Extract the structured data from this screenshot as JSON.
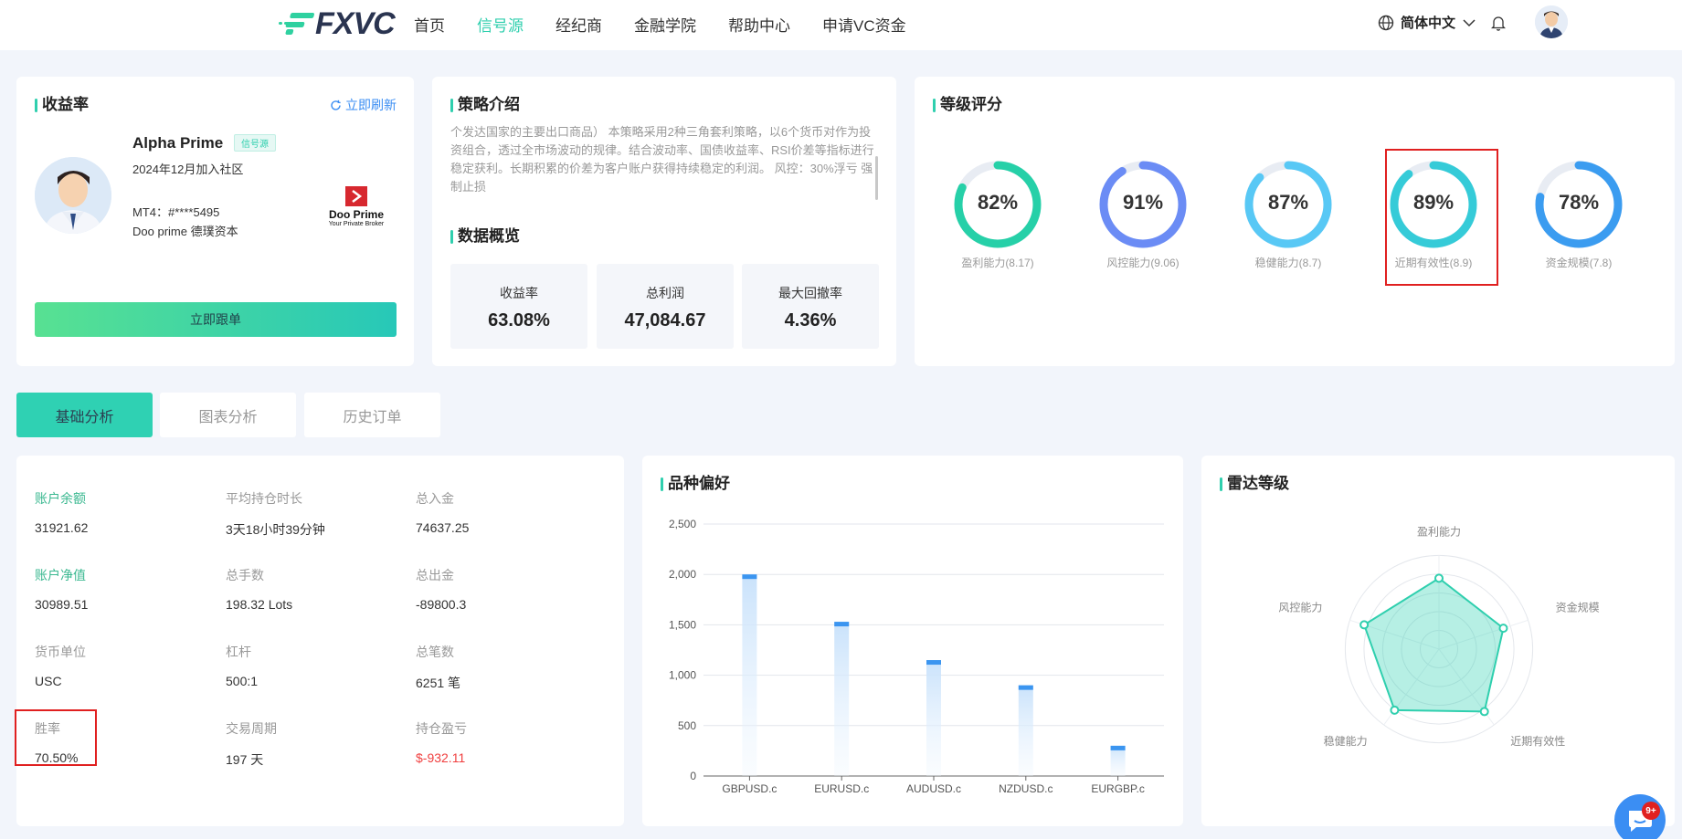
{
  "header": {
    "logo": "FXVC",
    "nav": [
      "首页",
      "信号源",
      "经纪商",
      "金融学院",
      "帮助中心",
      "申请VC资金"
    ],
    "active_nav": "信号源",
    "language": "简体中文"
  },
  "profile": {
    "title": "收益率",
    "refresh_label": "立即刷新",
    "name": "Alpha Prime",
    "tag": "信号源",
    "joined": "2024年12月加入社区",
    "mt4": "MT4：#****5495",
    "broker": "Doo prime 德璞资本",
    "broker_logo_name": "Doo Prime",
    "broker_logo_sub": "Your Private Broker",
    "follow_label": "立即跟单"
  },
  "strategy": {
    "title": "策略介绍",
    "text": "个发达国家的主要出口商品） 本策略采用2种三角套利策略，以6个货币对作为投资组合，透过全市场波动的规律。结合波动率、国债收益率、RSI价差等指标进行稳定获利。长期积累的价差为客户账户获得持续稳定的利润。 风控：30%浮亏 强制止损",
    "overview_title": "数据概览",
    "stats": [
      {
        "label": "收益率",
        "value": "63.08%"
      },
      {
        "label": "总利润",
        "value": "47,084.67"
      },
      {
        "label": "最大回撤率",
        "value": "4.36%"
      }
    ]
  },
  "rating": {
    "title": "等级评分",
    "items": [
      {
        "pct": "82%",
        "label": "盈利能力(8.17)",
        "value": 82,
        "color": "#26d0a8"
      },
      {
        "pct": "91%",
        "label": "风控能力(9.06)",
        "value": 91,
        "color": "#6b8cf5"
      },
      {
        "pct": "87%",
        "label": "稳健能力(8.7)",
        "value": 87,
        "color": "#58c8f5"
      },
      {
        "pct": "89%",
        "label": "近期有效性(8.9)",
        "value": 89,
        "color": "#35cbd8"
      },
      {
        "pct": "78%",
        "label": "资金规模(7.8)",
        "value": 78,
        "color": "#3b9cf0"
      }
    ]
  },
  "tabs": [
    "基础分析",
    "图表分析",
    "历史订单"
  ],
  "account": {
    "fields": [
      {
        "label": "账户余额",
        "value": "31921.62"
      },
      {
        "label": "平均持仓时长",
        "value": "3天18小时39分钟"
      },
      {
        "label": "总入金",
        "value": "74637.25"
      },
      {
        "label": "账户净值",
        "value": "30989.51"
      },
      {
        "label": "总手数",
        "value": "198.32 Lots"
      },
      {
        "label": "总出金",
        "value": "-89800.3"
      },
      {
        "label": "货币单位",
        "value": "USC"
      },
      {
        "label": "杠杆",
        "value": "500:1"
      },
      {
        "label": "总笔数",
        "value": "6251 笔"
      },
      {
        "label": "胜率",
        "value": "70.50%"
      },
      {
        "label": "交易周期",
        "value": "197 天"
      },
      {
        "label": "持仓盈亏",
        "value": "$-932.11"
      }
    ]
  },
  "preference": {
    "title": "品种偏好"
  },
  "radar": {
    "title": "雷达等级"
  },
  "chat": {
    "badge": "9+"
  },
  "chart_data": [
    {
      "type": "bar",
      "title": "品种偏好",
      "categories": [
        "GBPUSD.c",
        "EURUSD.c",
        "AUDUSD.c",
        "NZDUSD.c",
        "EURGBP.c"
      ],
      "values": [
        2000,
        1530,
        1150,
        900,
        300
      ],
      "ylim": [
        0,
        2500
      ],
      "yticks": [
        "0",
        "500",
        "1,000",
        "1,500",
        "2,000",
        "2,500"
      ],
      "grid": true
    },
    {
      "type": "radar",
      "title": "雷达等级",
      "axes": [
        "盈利能力",
        "资金规模",
        "近期有效性",
        "稳健能力",
        "风控能力"
      ],
      "values": [
        8.17,
        7.8,
        8.9,
        8.7,
        9.06
      ],
      "range": [
        0,
        10
      ]
    }
  ]
}
